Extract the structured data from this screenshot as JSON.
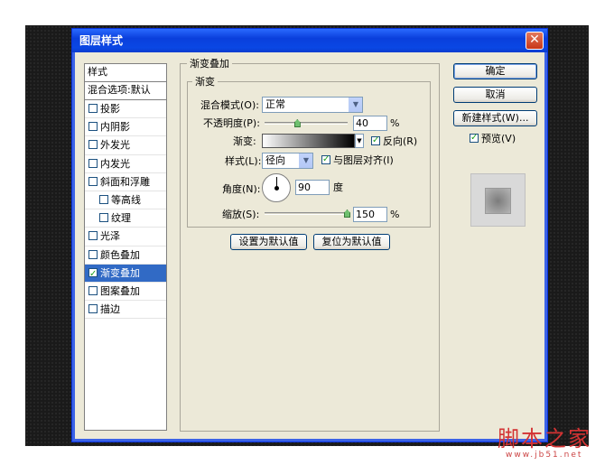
{
  "dialog": {
    "title": "图层样式",
    "close_glyph": "✕"
  },
  "style_list": {
    "header": "样式",
    "blend_options": "混合选项:默认",
    "items": [
      {
        "label": "投影",
        "checked": false,
        "indent": false
      },
      {
        "label": "内阴影",
        "checked": false,
        "indent": false
      },
      {
        "label": "外发光",
        "checked": false,
        "indent": false
      },
      {
        "label": "内发光",
        "checked": false,
        "indent": false
      },
      {
        "label": "斜面和浮雕",
        "checked": false,
        "indent": false
      },
      {
        "label": "等高线",
        "checked": false,
        "indent": true
      },
      {
        "label": "纹理",
        "checked": false,
        "indent": true
      },
      {
        "label": "光泽",
        "checked": false,
        "indent": false
      },
      {
        "label": "颜色叠加",
        "checked": false,
        "indent": false
      },
      {
        "label": "渐变叠加",
        "checked": true,
        "indent": false,
        "selected": true
      },
      {
        "label": "图案叠加",
        "checked": false,
        "indent": false
      },
      {
        "label": "描边",
        "checked": false,
        "indent": false
      }
    ]
  },
  "gradient_overlay": {
    "group_title": "渐变叠加",
    "sub_title": "渐变",
    "blend_mode_label": "混合模式(O):",
    "blend_mode_value": "正常",
    "opacity_label": "不透明度(P):",
    "opacity_value": "40",
    "opacity_fraction": 0.4,
    "percent": "%",
    "gradient_label": "渐变:",
    "reverse_label": "反向(R)",
    "reverse_checked": true,
    "style_label": "样式(L):",
    "style_value": "径向",
    "align_label": "与图层对齐(I)",
    "align_checked": true,
    "angle_label": "角度(N):",
    "angle_value": "90",
    "angle_unit": "度",
    "scale_label": "缩放(S):",
    "scale_value": "150",
    "scale_fraction": 1.0,
    "set_default_label": "设置为默认值",
    "reset_default_label": "复位为默认值"
  },
  "actions": {
    "ok_label": "确定",
    "cancel_label": "取消",
    "new_style_label": "新建样式(W)...",
    "preview_label": "预览(V)",
    "preview_checked": true
  },
  "watermark": {
    "text": "脚本之家",
    "url": "www.jb51.net",
    "color": "#d33333"
  },
  "colors": {
    "titlebar": "#0a47e4",
    "selection": "#316ac5",
    "panel_bg": "#ece9d8"
  }
}
